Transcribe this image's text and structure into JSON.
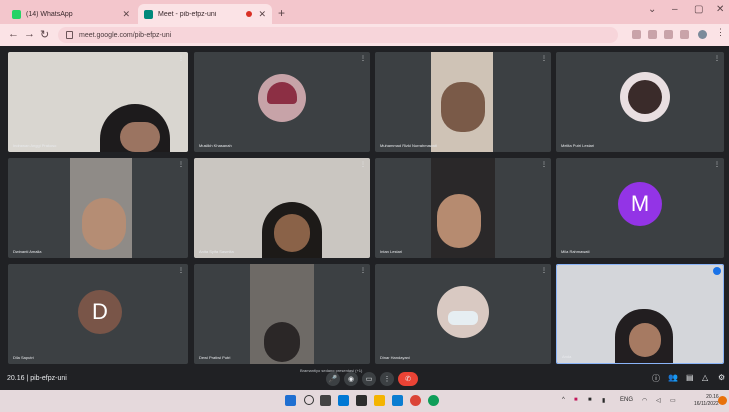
{
  "browser": {
    "tabs": [
      {
        "label": "(14) WhatsApp",
        "active": false
      },
      {
        "label": "Meet - pib-efpz-uni",
        "active": true
      }
    ],
    "address": "meet.google.com/pib-efpz-uni"
  },
  "meet": {
    "meeting_label": "20.16 | pib-efpz-uni",
    "participants": [
      {
        "name": "Indrawan Anggi Prakoso",
        "type": "camera"
      },
      {
        "name": "Muslikh Khasanah",
        "type": "photo"
      },
      {
        "name": "Muhammad Rizki Nurrahmawati",
        "type": "camera"
      },
      {
        "name": "Melita Putri Lestari",
        "type": "photo"
      },
      {
        "name": "Dwinanti Amalia",
        "type": "camera"
      },
      {
        "name": "Anita Syifa Sasmita",
        "type": "camera"
      },
      {
        "name": "Intan Lestari",
        "type": "camera"
      },
      {
        "name": "Mila Rahmawati",
        "type": "letter",
        "letter": "M",
        "color": "#9334e6"
      },
      {
        "name": "Dila Saputri",
        "type": "letter",
        "letter": "D",
        "color": "#795548"
      },
      {
        "name": "Dewi Pratiwi Putri",
        "type": "camera"
      },
      {
        "name": "Dinar Handayani",
        "type": "photo"
      },
      {
        "name": "Anda",
        "type": "camera"
      }
    ],
    "presenting_note": "Bramantiyo sedang presentasi (+1)"
  },
  "taskbar": {
    "tray_lang": "ENG",
    "clock_time": "20.16",
    "clock_date": "16/11/2022"
  }
}
